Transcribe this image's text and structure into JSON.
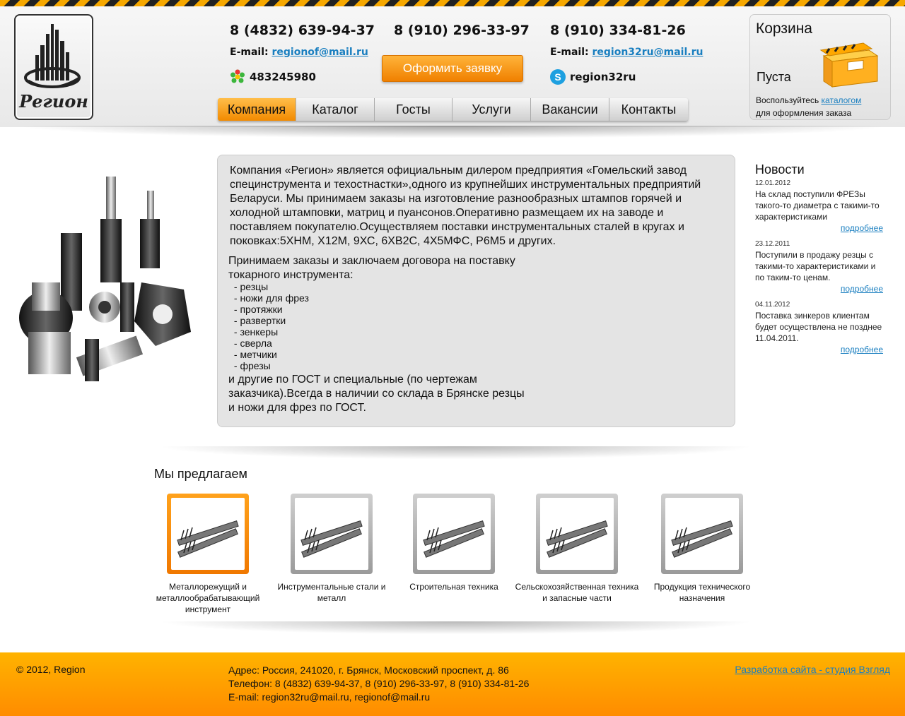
{
  "logo": {
    "text": "Регион"
  },
  "contacts": {
    "phones": [
      "8 (4832) 639-94-37",
      "8 (910) 296-33-97",
      "8 (910) 334-81-26"
    ],
    "email_label": "E-mail:",
    "email_1": "regionof@mail.ru",
    "email_2": "region32ru@mail.ru",
    "icq": "483245980",
    "skype": "region32ru"
  },
  "order_button": "Оформить заявку",
  "nav": {
    "items": [
      "Компания",
      "Каталог",
      "Госты",
      "Услуги",
      "Вакансии",
      "Контакты"
    ],
    "active": "Компания"
  },
  "cart": {
    "title": "Корзина",
    "status": "Пуста",
    "note_before": "Воспользуйтесь ",
    "note_link": "каталогом",
    "note_after": "для оформления заказа"
  },
  "intro": {
    "paragraph_1": "Компания «Регион» является официальным дилером предприятия «Гомельский завод специнструмента и техостнастки»,одного из крупнейших инструментальных предприятий Беларуси. Мы принимаем заказы на изготовление разнообразных штампов горячей и холодной штамповки, матриц и пуансонов.Оперативно размещаем их на заводе и поставляем покупателю.Осуществляем поставки инструментальных сталей в кругах и поковках:5ХНМ, Х12М, 9ХС, 6ХВ2С, 4Х5МФС, Р6М5 и других.",
    "paragraph_2": "Принимаем заказы и заключаем договора на поставку токарного инструмента:",
    "list": [
      "резцы",
      "ножи для фрез",
      "протяжки",
      "развертки",
      "зенкеры",
      "сверла",
      "метчики",
      "фрезы"
    ],
    "paragraph_3": "и другие по ГОСТ и специальные (по чертежам заказчика).Всегда в наличии со склада в Брянске резцы и ножи для фрез по ГОСТ."
  },
  "news": {
    "title": "Новости",
    "more_label": "подробнее",
    "items": [
      {
        "date": "12.01.2012",
        "text": "На склад поступили ФРЕЗы такого-то диаметра с такими-то характеристиками"
      },
      {
        "date": "23.12.2011",
        "text": "Поступили в продажу резцы с такими-то характеристиками и по таким-то ценам."
      },
      {
        "date": "04.11.2012",
        "text": "Поставка зинкеров клиентам будет осуществлена не позднее 11.04.2011."
      }
    ]
  },
  "offers": {
    "title": "Мы предлагаем",
    "items": [
      {
        "label": "Металлорежущий и металлообрабатывающий инструмент"
      },
      {
        "label": "Инструментальные стали и металл"
      },
      {
        "label": "Строительная техника"
      },
      {
        "label": "Сельскохозяйственная техника и запасные части"
      },
      {
        "label": "Продукция технического назначения"
      }
    ]
  },
  "footer": {
    "copyright": "© 2012, Region",
    "address": "Адрес: Россия, 241020, г. Брянск, Московский проспект, д. 86",
    "phones": "Телефон: 8 (4832) 639-94-37, 8 (910) 296-33-97, 8 (910) 334-81-26",
    "emails": "E-mail: region32ru@mail.ru, regionof@mail.ru",
    "developer_link": "Разработка сайта - студия Взгляд"
  },
  "colors": {
    "accent": "#f28a00",
    "link": "#1a7fc0",
    "panel": "#e4e4e4"
  }
}
